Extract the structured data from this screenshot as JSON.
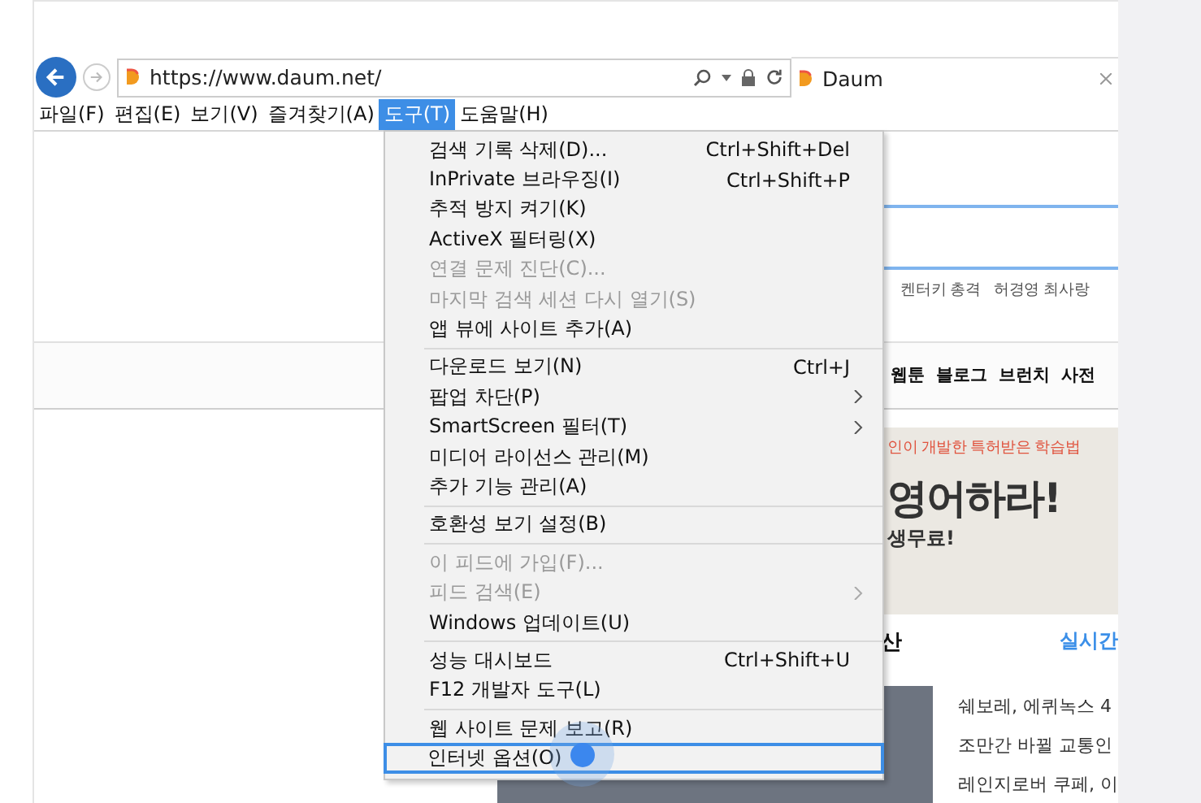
{
  "address_bar": {
    "value": "https://www.daum.net/"
  },
  "tab": {
    "title": "Daum"
  },
  "menu_bar": [
    {
      "label": "파일(F)",
      "selected": false
    },
    {
      "label": "편집(E)",
      "selected": false
    },
    {
      "label": "보기(V)",
      "selected": false
    },
    {
      "label": "즐겨찾기(A)",
      "selected": false
    },
    {
      "label": "도구(T)",
      "selected": true
    },
    {
      "label": "도움말(H)",
      "selected": false
    }
  ],
  "tools_menu": [
    [
      {
        "label": "검색 기록 삭제(D)...",
        "shortcut": "Ctrl+Shift+Del",
        "disabled": false,
        "submenu": false,
        "selected": false
      },
      {
        "label": "InPrivate 브라우징(I)",
        "shortcut": "Ctrl+Shift+P",
        "disabled": false,
        "submenu": false,
        "selected": false
      },
      {
        "label": "추적 방지 켜기(K)",
        "disabled": false,
        "submenu": false,
        "selected": false
      },
      {
        "label": "ActiveX 필터링(X)",
        "disabled": false,
        "submenu": false,
        "selected": false
      },
      {
        "label": "연결 문제 진단(C)...",
        "disabled": true,
        "submenu": false,
        "selected": false
      },
      {
        "label": "마지막 검색 세션 다시 열기(S)",
        "disabled": true,
        "submenu": false,
        "selected": false
      },
      {
        "label": "앱 뷰에 사이트 추가(A)",
        "disabled": false,
        "submenu": false,
        "selected": false
      }
    ],
    [
      {
        "label": "다운로드 보기(N)",
        "shortcut": "Ctrl+J",
        "disabled": false,
        "submenu": false,
        "selected": false
      },
      {
        "label": "팝업 차단(P)",
        "disabled": false,
        "submenu": true,
        "selected": false
      },
      {
        "label": "SmartScreen 필터(T)",
        "disabled": false,
        "submenu": true,
        "selected": false
      },
      {
        "label": "미디어 라이선스 관리(M)",
        "disabled": false,
        "submenu": false,
        "selected": false
      },
      {
        "label": "추가 기능 관리(A)",
        "disabled": false,
        "submenu": false,
        "selected": false
      }
    ],
    [
      {
        "label": "호환성 보기 설정(B)",
        "disabled": false,
        "submenu": false,
        "selected": false
      }
    ],
    [
      {
        "label": "이 피드에 가입(F)...",
        "disabled": true,
        "submenu": false,
        "selected": false
      },
      {
        "label": "피드 검색(E)",
        "disabled": true,
        "submenu": true,
        "selected": false
      },
      {
        "label": "Windows 업데이트(U)",
        "disabled": false,
        "submenu": false,
        "selected": false
      }
    ],
    [
      {
        "label": "성능 대시보드",
        "shortcut": "Ctrl+Shift+U",
        "disabled": false,
        "submenu": false,
        "selected": false
      },
      {
        "label": "F12 개발자 도구(L)",
        "disabled": false,
        "submenu": false,
        "selected": false
      }
    ],
    [
      {
        "label": "웹 사이트 문제 보고(R)",
        "disabled": false,
        "submenu": false,
        "selected": false
      },
      {
        "label": "인터넷 옵션(O)",
        "disabled": false,
        "submenu": false,
        "selected": true
      }
    ]
  ],
  "page": {
    "trending": [
      "켄터키 총격",
      "허경영 최사랑"
    ],
    "nav": [
      "웹툰",
      "블로그",
      "브런치",
      "사전"
    ],
    "ad": {
      "tagline": "인이 개발한 특허받은 학습법",
      "headline": "영어하라!",
      "footer": "생무료!"
    },
    "section": {
      "heading": "산",
      "link": "실시간"
    },
    "news": [
      "쉐보레, 에퀴녹스 4",
      "조만간 바뀔 교통인",
      "레인지로버 쿠페, 이"
    ]
  }
}
